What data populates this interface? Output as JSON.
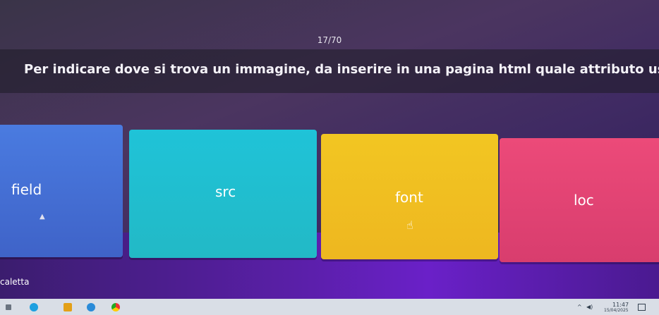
{
  "counter": "17/70",
  "question": "Per indicare dove si trova un immagine, da inserire in una pagina html quale attributo uso?",
  "answers": [
    {
      "label": "field",
      "color": "#4a7be0"
    },
    {
      "label": "src",
      "color": "#1fc3d8"
    },
    {
      "label": "font",
      "color": "#f2c622"
    },
    {
      "label": "loc",
      "color": "#ec4a79"
    }
  ],
  "footer_text": "caletta",
  "taskbar": {
    "time": "11:47",
    "date": "15/04/2025"
  }
}
